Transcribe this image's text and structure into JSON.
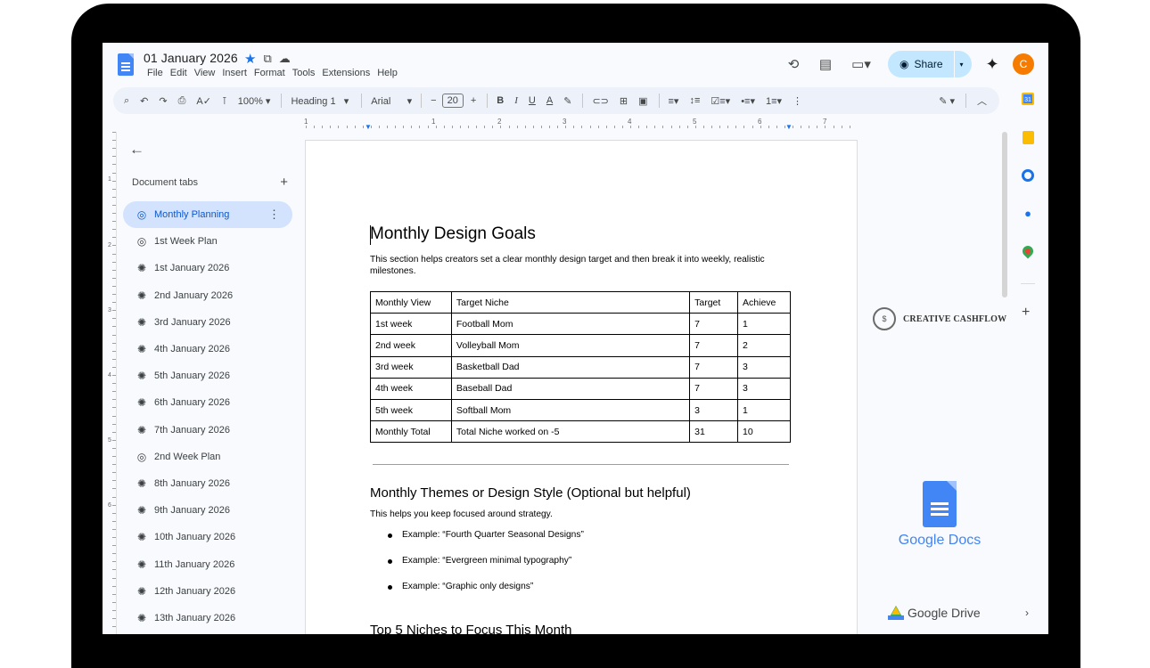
{
  "document": {
    "title": "01 January 2026",
    "menu": [
      "File",
      "Edit",
      "View",
      "Insert",
      "Format",
      "Tools",
      "Extensions",
      "Help"
    ],
    "share_label": "Share",
    "avatar_initial": "C"
  },
  "toolbar": {
    "zoom": "100%",
    "style": "Heading 1",
    "font": "Arial",
    "font_size": "20",
    "icons": [
      "search-icon",
      "undo-icon",
      "redo-icon",
      "print-icon",
      "spellcheck-icon",
      "paint-format-icon",
      "bold-icon",
      "italic-icon",
      "underline-icon",
      "text-color-icon",
      "highlight-icon",
      "link-icon",
      "comment-icon",
      "image-icon",
      "align-icon",
      "line-spacing-icon",
      "checklist-icon",
      "bullet-list-icon",
      "numbered-list-icon",
      "more-icon",
      "edit-mode-icon",
      "collapse-icon"
    ]
  },
  "ruler": {
    "numbers": [
      "1",
      "1",
      "2",
      "3",
      "4",
      "5",
      "6",
      "7"
    ]
  },
  "vruler": {
    "numbers": [
      "1",
      "2",
      "3",
      "4",
      "5",
      "6"
    ]
  },
  "sidebar": {
    "heading": "Document tabs",
    "tabs": [
      {
        "label": "Monthly Planning",
        "icon": "tab-target-icon",
        "active": true
      },
      {
        "label": "1st Week Plan",
        "icon": "tab-target-icon"
      },
      {
        "label": "1st January 2026",
        "icon": "tab-swirl-icon"
      },
      {
        "label": "2nd January 2026",
        "icon": "tab-swirl-icon"
      },
      {
        "label": "3rd January 2026",
        "icon": "tab-swirl-icon"
      },
      {
        "label": "4th January 2026",
        "icon": "tab-swirl-icon"
      },
      {
        "label": "5th January 2026",
        "icon": "tab-swirl-icon"
      },
      {
        "label": "6th January 2026",
        "icon": "tab-swirl-icon"
      },
      {
        "label": "7th January 2026",
        "icon": "tab-swirl-icon"
      },
      {
        "label": "2nd Week Plan",
        "icon": "tab-target-icon"
      },
      {
        "label": "8th January 2026",
        "icon": "tab-swirl-icon"
      },
      {
        "label": "9th January 2026",
        "icon": "tab-swirl-icon"
      },
      {
        "label": "10th January 2026",
        "icon": "tab-swirl-icon"
      },
      {
        "label": "11th January 2026",
        "icon": "tab-swirl-icon"
      },
      {
        "label": "12th January 2026",
        "icon": "tab-swirl-icon"
      },
      {
        "label": "13th January 2026",
        "icon": "tab-swirl-icon"
      }
    ]
  },
  "page": {
    "heading": "Monthly Design Goals",
    "intro": "This section helps creators set a clear monthly design target and then break it into weekly, realistic milestones.",
    "table": {
      "headers": [
        "Monthly View",
        "Target Niche",
        "Target",
        "Achieve"
      ],
      "rows": [
        [
          "1st week",
          "Football Mom",
          "7",
          "1"
        ],
        [
          "2nd week",
          "Volleyball Mom",
          "7",
          "2"
        ],
        [
          "3rd week",
          "Basketball Dad",
          "7",
          "3"
        ],
        [
          "4th week",
          "Baseball Dad",
          "7",
          "3"
        ],
        [
          "5th week",
          "Softball Mom",
          "3",
          "1"
        ],
        [
          "Monthly Total",
          "Total Niche worked on -5",
          "31",
          "10"
        ]
      ]
    },
    "themes_heading": "Monthly Themes or Design Style (Optional but helpful)",
    "themes_intro": "This helps you keep focused around strategy.",
    "examples": [
      "Example: “Fourth Quarter Seasonal Designs”",
      "Example: “Evergreen minimal typography”",
      "Example: “Graphic only designs”"
    ],
    "niches_heading": "Top 5 Niches to Focus This Month"
  },
  "branding": {
    "creative_cashflow": "CREATIVE CASHFLOW",
    "google_docs": "Google Docs",
    "google_drive": "Google Drive"
  },
  "colors": {
    "accent": "#1a73e8",
    "share_bg": "#c2e7ff",
    "active_tab_bg": "#d3e3fd",
    "avatar_bg": "#f57c00"
  }
}
